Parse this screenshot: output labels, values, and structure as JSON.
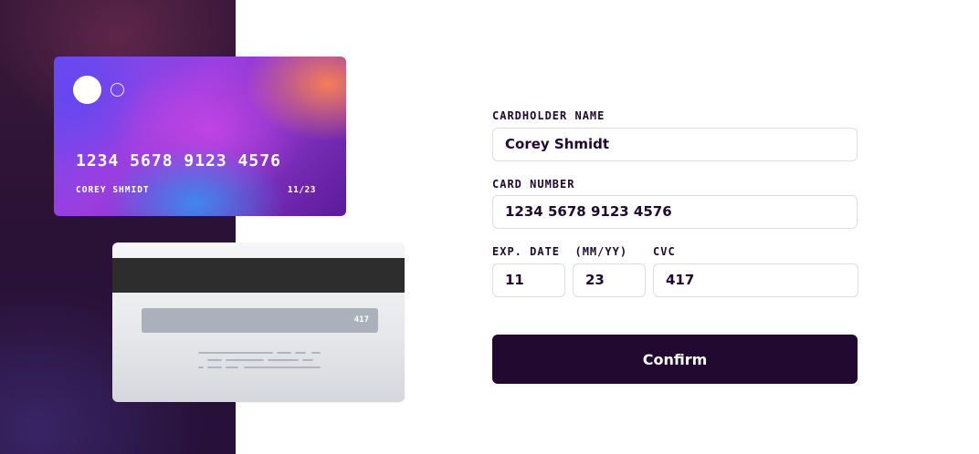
{
  "card_front": {
    "number": "1234 5678 9123 4576",
    "name": "COREY SHMIDT",
    "expiry": "11/23"
  },
  "card_back": {
    "cvc": "417"
  },
  "form": {
    "cardholder_label": "CARDHOLDER NAME",
    "cardholder_value": "Corey Shmidt",
    "number_label": "CARD NUMBER",
    "number_value": "1234 5678 9123 4576",
    "exp_label": "EXP. DATE  (MM/YY)",
    "exp_month_value": "11",
    "exp_year_value": "23",
    "cvc_label": "CVC",
    "cvc_value": "417",
    "confirm_label": "Confirm"
  },
  "colors": {
    "accent": "#21092f",
    "border": "#dedddf",
    "panel": "#2a1236"
  }
}
